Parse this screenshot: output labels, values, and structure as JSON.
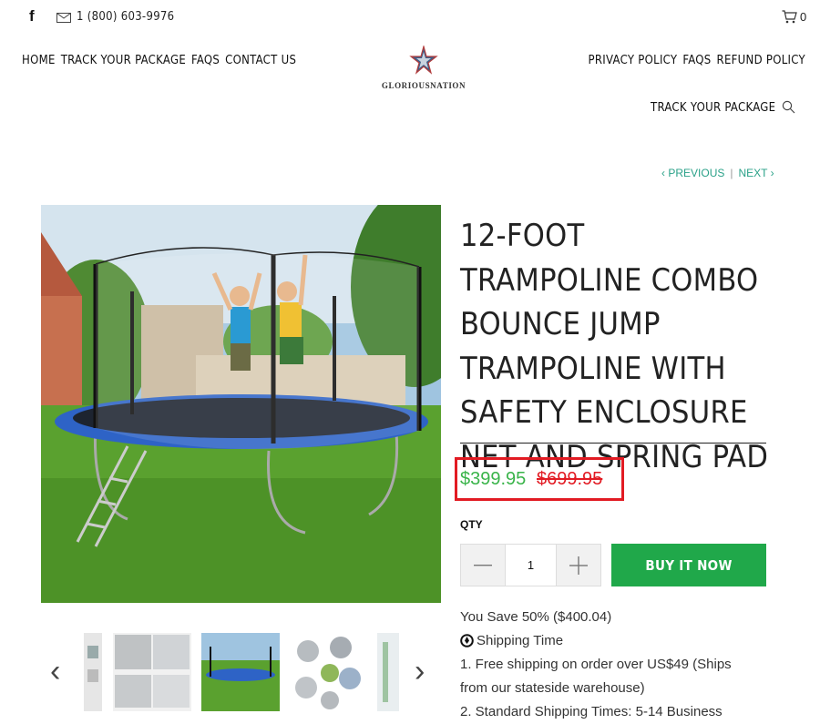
{
  "topbar": {
    "facebook_icon": "facebook-icon",
    "mail_icon": "mail-icon",
    "phone": "1 (800) 603-9976",
    "cart_icon": "cart-icon",
    "cart_count": "0"
  },
  "nav": {
    "left": [
      "HOME",
      "TRACK YOUR PACKAGE",
      "FAQS",
      "CONTACT US"
    ],
    "right": [
      "PRIVACY POLICY",
      "FAQS",
      "REFUND POLICY"
    ],
    "track_secondary": "TRACK YOUR PACKAGE",
    "search_icon": "search-icon"
  },
  "logo": {
    "text": "GLORIOUSNATION"
  },
  "pager": {
    "previous": "PREVIOUS",
    "separator": "|",
    "next": "NEXT"
  },
  "product": {
    "title": "12-FOOT TRAMPOLINE COMBO BOUNCE JUMP TRAMPOLINE WITH SAFETY ENCLOSURE NET AND SPRING PAD",
    "price_now": "$399.95",
    "price_was": "$699.95",
    "qty_label": "QTY",
    "qty_value": "1",
    "buy_label": "BUY IT NOW",
    "you_save": "You Save 50% ($400.04)",
    "shipping_time": "Shipping Time",
    "ship_line_1": "1. Free shipping on order over US$49 (Ships",
    "ship_line_2": "from our stateside warehouse)",
    "ship_line_3": "2. Standard Shipping Times: 5-14 Business"
  },
  "colors": {
    "accent_teal": "#2aa188",
    "price_green": "#3ab44a",
    "price_red": "#e21b23",
    "buy_green": "#20a84a"
  }
}
